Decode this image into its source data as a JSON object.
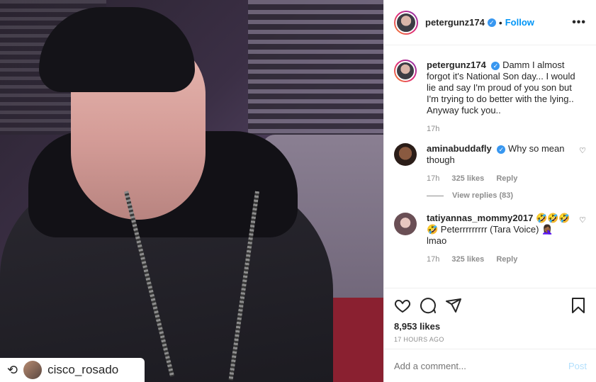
{
  "post": {
    "repost_label": "cisco_rosado",
    "repost_icon": "repost-icon"
  },
  "header": {
    "username": "petergunz174",
    "verified_icon": "verified-badge-icon",
    "separator": "•",
    "follow_label": "Follow",
    "more_label": "•••"
  },
  "caption": {
    "username": "petergunz174",
    "text": "Damm I almost forgot it's National Son day... I would lie and say I'm proud of you son but I'm trying to do better with the lying.. Anyway fuck you..",
    "time": "17h"
  },
  "comments": [
    {
      "username": "aminabuddafly",
      "text": "Why so mean though",
      "time": "17h",
      "likes": "325 likes",
      "reply_label": "Reply",
      "view_replies": "View replies (83)"
    },
    {
      "username": "tatiyannas_mommy2017",
      "text": "🤣🤣🤣🤣 Peterrrrrrrrr (Tara Voice) 🤦🏾‍♀️ lmao",
      "time": "17h",
      "likes": "325 likes",
      "reply_label": "Reply"
    }
  ],
  "actions": {
    "likes": "8,953 likes",
    "timestamp": "17 HOURS AGO"
  },
  "add_comment": {
    "placeholder": "Add a comment...",
    "post_label": "Post"
  },
  "colors": {
    "link_blue": "#0095f6",
    "verified_blue": "#3897f0",
    "post_disabled": "#b2dffc",
    "muted": "#8e8e8e"
  }
}
